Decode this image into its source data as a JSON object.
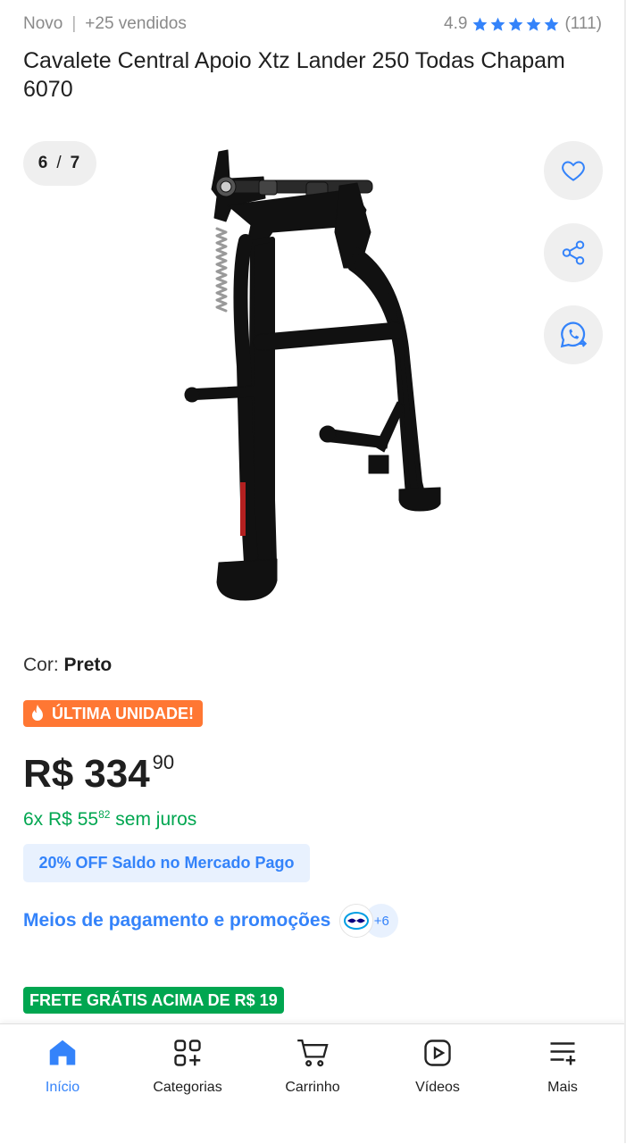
{
  "header": {
    "condition": "Novo",
    "sold": "+25 vendidos",
    "rating_value": "4.9",
    "rating_stars": 5,
    "rating_count": "(111)"
  },
  "product": {
    "title": "Cavalete Central Apoio Xtz Lander 250 Todas Chapam 6070"
  },
  "gallery": {
    "current": "6",
    "separator": "/",
    "total": "7"
  },
  "actions": {
    "favorite_icon": "heart-icon",
    "share_icon": "share-icon",
    "whatsapp_icon": "whatsapp-icon"
  },
  "variation": {
    "label": "Cor:",
    "value": "Preto"
  },
  "badges": {
    "last_unit": "ÚLTIMA UNIDADE!",
    "free_shipping": "FRETE GRÁTIS ACIMA DE R$ 19"
  },
  "price": {
    "currency": "R$",
    "integer": "334",
    "cents": "90"
  },
  "installments": {
    "prefix": "6x R$ 55",
    "cents": "82",
    "suffix": "sem juros"
  },
  "promo": {
    "text": "20% OFF Saldo no Mercado Pago"
  },
  "payments": {
    "link": "Meios de pagamento e promoções",
    "more": "+6"
  },
  "nav": {
    "items": [
      {
        "label": "Início",
        "icon": "home-icon",
        "active": true
      },
      {
        "label": "Categorias",
        "icon": "categories-icon",
        "active": false
      },
      {
        "label": "Carrinho",
        "icon": "cart-icon",
        "active": false
      },
      {
        "label": "Vídeos",
        "icon": "video-icon",
        "active": false
      },
      {
        "label": "Mais",
        "icon": "more-menu-icon",
        "active": false
      }
    ]
  },
  "colors": {
    "accent_blue": "#3483fa",
    "green": "#00a650",
    "orange": "#ff7733",
    "star_blue": "#3483fa"
  }
}
